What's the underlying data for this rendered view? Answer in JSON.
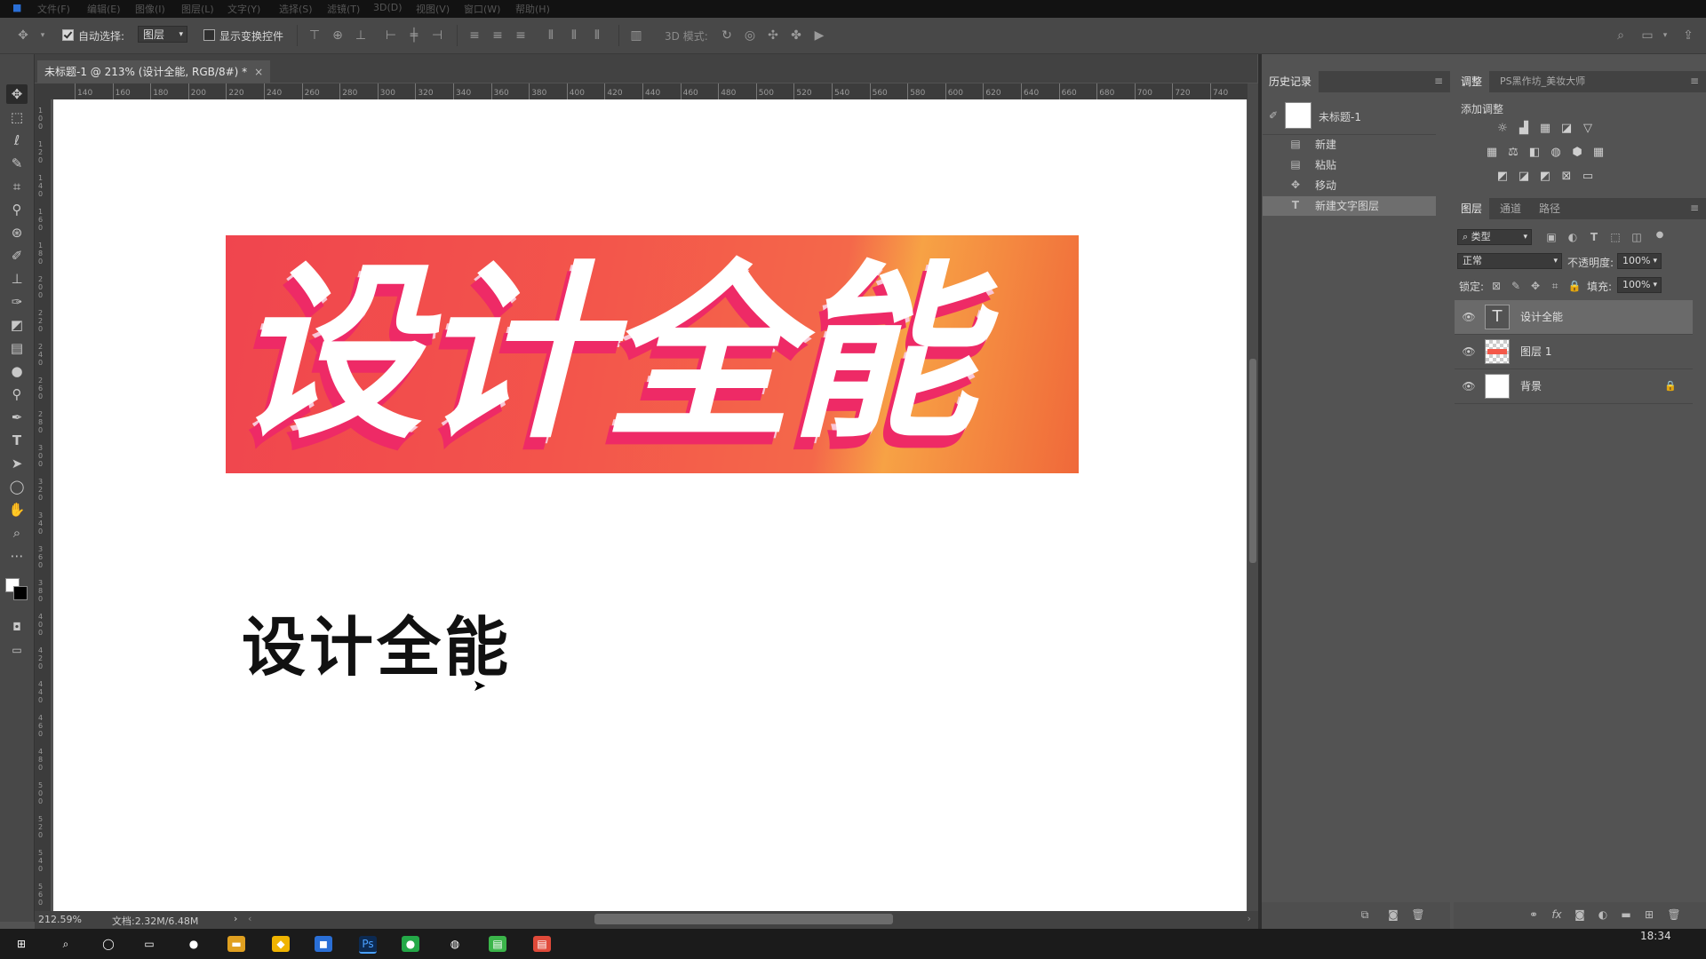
{
  "menubar": {
    "items": [
      "文件(F)",
      "编辑(E)",
      "图像(I)",
      "图层(L)",
      "文字(Y)",
      "选择(S)",
      "滤镜(T)",
      "3D(D)",
      "视图(V)",
      "窗口(W)",
      "帮助(H)"
    ]
  },
  "options": {
    "auto_select_label": "自动选择:",
    "auto_select_checked": true,
    "auto_select_value": "图层",
    "transform_label": "显示变换控件",
    "mode_3d_label": "3D 模式:"
  },
  "document": {
    "tab_title": "未标题-1 @ 213% (设计全能, RGB/8#) *",
    "close": "×",
    "banner_text": "设计全能",
    "plain_text": "设计全能",
    "zoom": "212.59%",
    "doc_size": "文档:2.32M/6.48M"
  },
  "ruler": {
    "h_ticks": [
      "140",
      "160",
      "180",
      "200",
      "220",
      "240",
      "260",
      "280",
      "300",
      "320",
      "340",
      "360",
      "380",
      "400",
      "420",
      "440",
      "460",
      "480",
      "500",
      "520",
      "540",
      "560",
      "580",
      "600",
      "620",
      "640",
      "660",
      "680",
      "700",
      "720",
      "740"
    ],
    "v_ticks": [
      "100",
      "120",
      "140",
      "160",
      "180",
      "200",
      "220",
      "240",
      "260",
      "280",
      "300",
      "320",
      "340",
      "360",
      "380",
      "400",
      "420",
      "440",
      "460",
      "480",
      "500",
      "520",
      "540",
      "560"
    ]
  },
  "history": {
    "tab": "历史记录",
    "snapshot": "未标题-1",
    "items": [
      {
        "icon": "doc-icon",
        "label": "新建"
      },
      {
        "icon": "doc-icon",
        "label": "粘贴"
      },
      {
        "icon": "move-icon",
        "label": "移动"
      },
      {
        "icon": "text-icon",
        "label": "新建文字图层"
      }
    ]
  },
  "adjust": {
    "tabs": [
      "调整",
      "PS黑作坊_美妆大师"
    ],
    "title": "添加调整"
  },
  "layers": {
    "tabs": [
      "图层",
      "通道",
      "路径"
    ],
    "filter_kind": "类型",
    "blend_mode": "正常",
    "opacity_label": "不透明度:",
    "opacity": "100%",
    "lock_label": "锁定:",
    "fill_label": "填充:",
    "fill": "100%",
    "items": [
      {
        "name": "设计全能",
        "kind": "text"
      },
      {
        "name": "图层 1",
        "kind": "image"
      },
      {
        "name": "背景",
        "kind": "background",
        "locked": true
      }
    ]
  },
  "taskbar": {
    "time": "18:34"
  }
}
